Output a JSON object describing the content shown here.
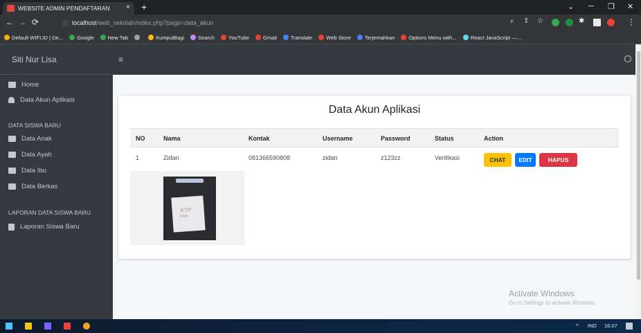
{
  "browser": {
    "tab_title": "WEBSITE ADMIN PENDAFTARAN",
    "tab_close": "×",
    "new_tab": "+",
    "window_controls": {
      "minimize": "─",
      "restore": "❐",
      "close": "✕",
      "dropdown": "⌄"
    },
    "url_host": "localhost",
    "url_path": "/web_sekolah/index.php?page=data_akun",
    "bookmarks": [
      {
        "label": "Default WIFI.ID | De...",
        "color": "#f4b400"
      },
      {
        "label": "Google",
        "color": "#34a853"
      },
      {
        "label": "New Tab",
        "color": "#34a853"
      },
      {
        "label": "",
        "color": "#9aa0a6"
      },
      {
        "label": "KumpulBagi",
        "color": "#fbbc05"
      },
      {
        "label": "Search",
        "color": "#c58af9"
      },
      {
        "label": "YouTube",
        "color": "#ea4335"
      },
      {
        "label": "Gmail",
        "color": "#ea4335"
      },
      {
        "label": "Translate",
        "color": "#4285f4"
      },
      {
        "label": "Web Store",
        "color": "#ea4335"
      },
      {
        "label": "Terjemahkan",
        "color": "#4285f4"
      },
      {
        "label": "Options Menu with...",
        "color": "#ea4335"
      },
      {
        "label": "React JavaScript —...",
        "color": "#61dafb"
      }
    ]
  },
  "sidebar": {
    "brand": "Siti Nur Lisa",
    "items": [
      {
        "label": "Home"
      },
      {
        "label": "Data Akun Aplikasi"
      }
    ],
    "section1_header": "DATA SISWA BARU",
    "section1_items": [
      {
        "label": "Data Anak"
      },
      {
        "label": "Data Ayah"
      },
      {
        "label": "Data Ibu"
      },
      {
        "label": "Data Berkas"
      }
    ],
    "section2_header": "LAPORAN DATA SISWA BARU",
    "section2_items": [
      {
        "label": "Laporan Siswa Baru"
      }
    ]
  },
  "topnav": {
    "menu_toggle": "≡"
  },
  "main": {
    "title": "Data Akun Aplikasi",
    "columns": [
      "NO",
      "Nama",
      "Kontak",
      "Username",
      "Password",
      "Status",
      "Action"
    ],
    "rows": [
      {
        "no": "1",
        "nama": "Zidan",
        "kontak": "081366590808",
        "username": "zidan",
        "password": "z123zz",
        "status": "Verifikasi"
      }
    ],
    "buttons": {
      "chat": "CHAT",
      "edit": "EDIT",
      "hapus": "HAPUS"
    },
    "photo_text": "KTP",
    "photo_subtext": "Zidan"
  },
  "watermark": {
    "line1": "Activate Windows",
    "line2": "Go to Settings to activate Windows."
  },
  "taskbar": {
    "lang": "IND",
    "time": "16.07",
    "tray_arrow": "^"
  }
}
